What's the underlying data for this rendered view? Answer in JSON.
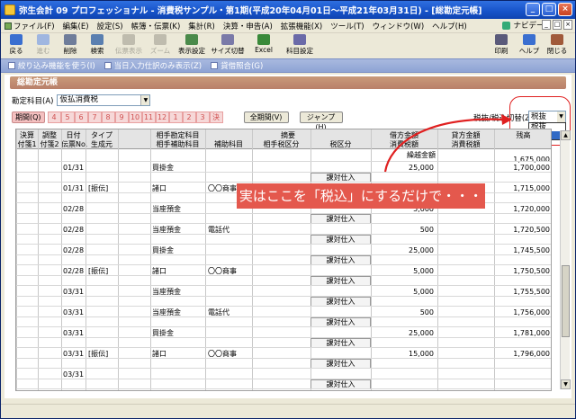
{
  "window": {
    "title": "弥生会計 09 プロフェッショナル - 消費税サンプル・第1期(平成20年04月01日～平成21年03月31日) - [総勘定元帳]",
    "controls": [
      "_",
      "□",
      "×"
    ]
  },
  "menubar": {
    "items": [
      "ファイル(F)",
      "編集(E)",
      "設定(S)",
      "帳簿・伝票(K)",
      "集計(R)",
      "決算・申告(A)",
      "拡張機能(X)",
      "ツール(T)",
      "ウィンドウ(W)",
      "ヘルプ(H)"
    ],
    "navi_label": "ナビデータ",
    "mdi_buttons": [
      "_",
      "□",
      "×"
    ]
  },
  "toolbar": {
    "items": [
      {
        "label": "戻る",
        "icon": "back-arrow-icon",
        "color": "#3a6fd0",
        "enabled": true
      },
      {
        "label": "進む",
        "icon": "forward-arrow-icon",
        "color": "#9fb6e0",
        "enabled": false
      },
      {
        "label": "削除",
        "icon": "delete-icon",
        "color": "#6f7d9a",
        "enabled": true
      },
      {
        "label": "検索",
        "icon": "search-icon",
        "color": "#5a7fb0",
        "enabled": true
      },
      {
        "label": "伝票表示",
        "icon": "slip-icon",
        "color": "#bfbcae",
        "enabled": false
      },
      {
        "label": "ズーム",
        "icon": "zoom-icon",
        "color": "#bfbcae",
        "enabled": false
      },
      {
        "label": "表示設定",
        "icon": "display-settings-icon",
        "color": "#4a8a4a",
        "enabled": true
      },
      {
        "label": "サイズ切替",
        "icon": "resize-icon",
        "color": "#7a7aa8",
        "enabled": true
      },
      {
        "label": "Excel",
        "icon": "excel-icon",
        "color": "#3a8a3a",
        "enabled": true
      },
      {
        "label": "科目設定",
        "icon": "account-settings-icon",
        "color": "#6a6aa8",
        "enabled": true
      }
    ],
    "right_items": [
      {
        "label": "印刷",
        "icon": "printer-icon",
        "color": "#5a5a7a"
      },
      {
        "label": "ヘルプ",
        "icon": "help-icon",
        "color": "#3a6fd0"
      },
      {
        "label": "閉じる",
        "icon": "close-door-icon",
        "color": "#a05a3a"
      }
    ]
  },
  "options": {
    "items": [
      "絞り込み機能を使う(I)",
      "当日入力仕訳のみ表示(Z)",
      "貸借照合(G)"
    ]
  },
  "ledger": {
    "section_title": "総勘定元帳",
    "account_label": "勘定科目(A)",
    "account_value": "仮払消費税",
    "period_label": "期間(Q)",
    "months": [
      "4",
      "5",
      "6",
      "7",
      "8",
      "9",
      "10",
      "11",
      "12",
      "1",
      "2",
      "3",
      "決"
    ],
    "all_period_button": "全期間(V)",
    "jump_button": "ジャンプ(H)",
    "tax_mode_label": "税抜/税込切替(Z)",
    "tax_mode_value": "税抜",
    "tax_mode_options": [
      "税抜",
      "税込"
    ],
    "tax_mode_selected": 1
  },
  "grid": {
    "headers_top": [
      "決算",
      "調整",
      "日付",
      "タイプ",
      "相手勘定科目",
      "摘要",
      "借方金額",
      "貸方金額",
      "残高"
    ],
    "headers_bottom": [
      "付箋1",
      "付箋2",
      "伝票No.",
      "生成元",
      "相手補助科目",
      "補助科目",
      "相手税区分",
      "税区分",
      "消費税額",
      "消費税額"
    ],
    "carry_label": "繰越金額",
    "carry_balance": "1,675,000",
    "sub_label": "課対仕入",
    "rows": [
      {
        "date": "01/31",
        "gen": "",
        "account": "買掛金",
        "sub": "",
        "debit": "25,000",
        "balance": "1,700,000"
      },
      {
        "date": "01/31",
        "gen": "[振伝]",
        "account": "諸口",
        "sub": "〇〇商事",
        "debit": "15,000",
        "balance": "1,715,000"
      },
      {
        "date": "02/28",
        "gen": "",
        "account": "当座預金",
        "sub": "",
        "debit": "5,000",
        "balance": "1,720,000"
      },
      {
        "date": "02/28",
        "gen": "",
        "account": "当座預金",
        "sub": "電話代",
        "debit": "500",
        "balance": "1,720,500"
      },
      {
        "date": "02/28",
        "gen": "",
        "account": "買掛金",
        "sub": "",
        "debit": "25,000",
        "balance": "1,745,500"
      },
      {
        "date": "02/28",
        "gen": "[振伝]",
        "account": "諸口",
        "sub": "〇〇商事",
        "debit": "5,000",
        "balance": "1,750,500"
      },
      {
        "date": "03/31",
        "gen": "",
        "account": "当座預金",
        "sub": "",
        "debit": "5,000",
        "balance": "1,755,500"
      },
      {
        "date": "03/31",
        "gen": "",
        "account": "当座預金",
        "sub": "電話代",
        "debit": "500",
        "balance": "1,756,000"
      },
      {
        "date": "03/31",
        "gen": "",
        "account": "買掛金",
        "sub": "",
        "debit": "25,000",
        "balance": "1,781,000"
      },
      {
        "date": "03/31",
        "gen": "[振伝]",
        "account": "諸口",
        "sub": "〇〇商事",
        "debit": "15,000",
        "balance": "1,796,000"
      },
      {
        "date": "03/31",
        "gen": "",
        "account": "",
        "sub": "",
        "debit": "",
        "balance": ""
      }
    ]
  },
  "annotation": {
    "text": "実はここを「税込」にするだけで・・・",
    "color": "#e02020"
  }
}
